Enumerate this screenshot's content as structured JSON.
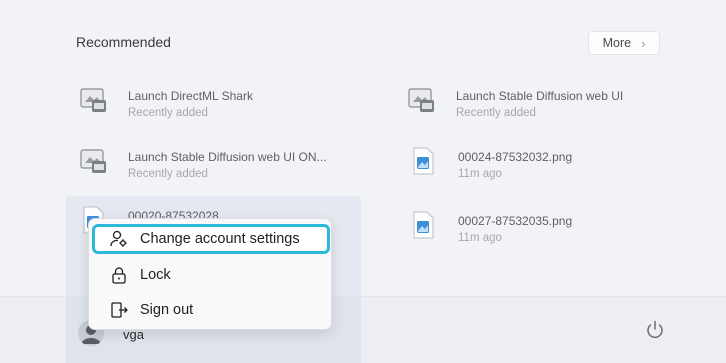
{
  "recommended": {
    "title": "Recommended",
    "more_label": "More",
    "more_chevron": "›",
    "items": [
      {
        "name": "Launch DirectML Shark",
        "sub": "Recently added",
        "icon": "app-shortcut-icon"
      },
      {
        "name": "Launch Stable Diffusion web UI",
        "sub": "Recently added",
        "icon": "app-shortcut-icon"
      },
      {
        "name": "Launch Stable Diffusion web UI ON...",
        "sub": "Recently added",
        "icon": "app-shortcut-icon"
      },
      {
        "name": "00024-87532032.png",
        "sub": "11m ago",
        "icon": "image-file-icon"
      },
      {
        "name": "00027-87532035.png",
        "sub": "11m ago",
        "icon": "image-file-icon"
      },
      {
        "name": "00020-87532028",
        "sub": "",
        "icon": "image-file-icon"
      }
    ]
  },
  "user": {
    "name": "vga"
  },
  "context_menu": {
    "items": [
      {
        "label": "Change account settings",
        "icon": "account-settings-icon"
      },
      {
        "label": "Lock",
        "icon": "lock-icon"
      },
      {
        "label": "Sign out",
        "icon": "sign-out-icon"
      }
    ]
  },
  "colors": {
    "focus_ring": "#2cb8d8",
    "panel_bg": "#f2f3f7"
  }
}
